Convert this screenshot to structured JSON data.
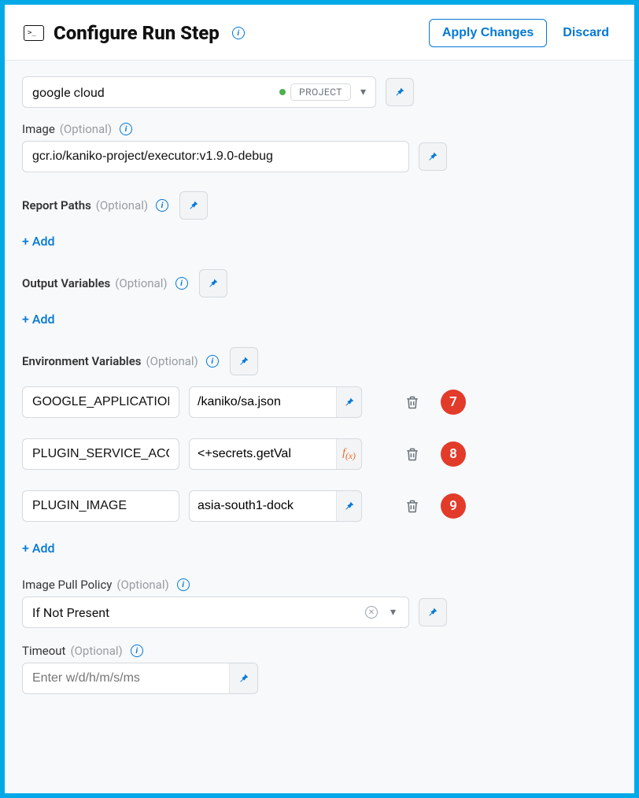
{
  "colors": {
    "accent": "#0278d5",
    "frame": "#03a9e7",
    "badge": "#e23b2a",
    "status_ok": "#4caf50"
  },
  "header": {
    "title": "Configure Run Step",
    "apply_label": "Apply Changes",
    "discard_label": "Discard"
  },
  "container_registry": {
    "value": "google cloud",
    "scope_tag": "PROJECT"
  },
  "image": {
    "label": "Image",
    "optional": "(Optional)",
    "value": "gcr.io/kaniko-project/executor:v1.9.0-debug"
  },
  "report_paths": {
    "label": "Report Paths",
    "optional": "(Optional)",
    "add_label": "+ Add"
  },
  "output_vars": {
    "label": "Output Variables",
    "optional": "(Optional)",
    "add_label": "+ Add"
  },
  "env_vars": {
    "label": "Environment Variables",
    "optional": "(Optional)",
    "rows": [
      {
        "key": "GOOGLE_APPLICATIONS",
        "value": "/kaniko/sa.json",
        "value_mode": "fixed",
        "badge": "7"
      },
      {
        "key": "PLUGIN_SERVICE_ACCOUNT",
        "value": "<+secrets.getVal",
        "value_mode": "expression",
        "badge": "8"
      },
      {
        "key": "PLUGIN_IMAGE",
        "value": "asia-south1-dock",
        "value_mode": "fixed",
        "badge": "9"
      }
    ],
    "add_label": "+ Add"
  },
  "image_pull_policy": {
    "label": "Image Pull Policy",
    "optional": "(Optional)",
    "value": "If Not Present"
  },
  "timeout": {
    "label": "Timeout",
    "optional": "(Optional)",
    "placeholder": "Enter w/d/h/m/s/ms",
    "value": ""
  }
}
